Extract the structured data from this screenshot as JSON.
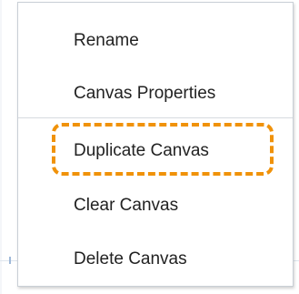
{
  "context_menu": {
    "items": [
      {
        "label": "Rename"
      },
      {
        "label": "Canvas Properties"
      },
      {
        "label": "Duplicate Canvas"
      },
      {
        "label": "Clear Canvas"
      },
      {
        "label": "Delete Canvas"
      }
    ],
    "highlighted_item": "Duplicate Canvas",
    "highlight_color": "#f0920a"
  }
}
